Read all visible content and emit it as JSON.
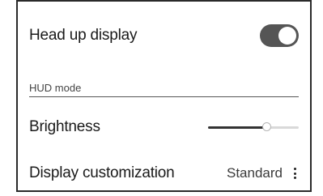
{
  "settings": {
    "hud_label": "Head up display",
    "hud_toggle_on": true,
    "hud_mode_header": "HUD mode",
    "brightness_label": "Brightness",
    "brightness_value": 0.64,
    "display_customization_label": "Display customization",
    "display_customization_value": "Standard",
    "more_icon": "vertical-ellipsis-icon"
  },
  "colors": {
    "toggle_on": "#555555",
    "slider_fill": "#333333",
    "slider_track": "#d9d9d9"
  }
}
